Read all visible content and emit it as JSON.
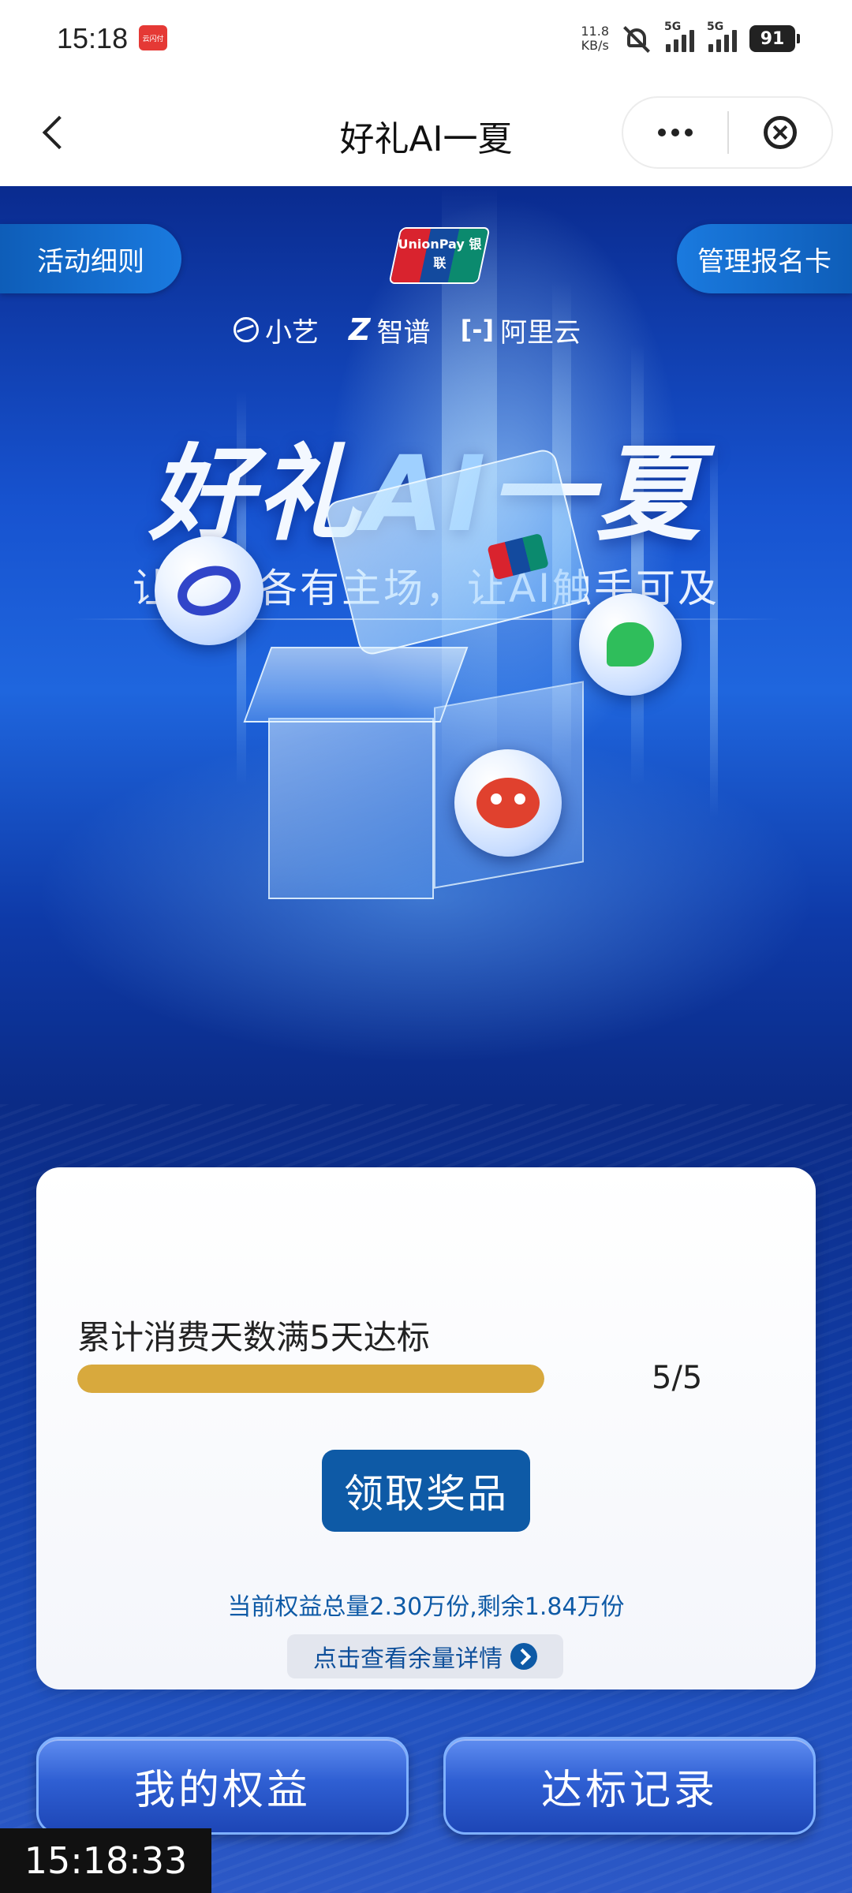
{
  "status_bar": {
    "time": "15:18",
    "app_badge": "云闪付",
    "net_speed_value": "11.8",
    "net_speed_unit": "KB/s",
    "signal_1_tag": "5G",
    "signal_2_tag": "5G",
    "battery": "91"
  },
  "nav": {
    "title": "好礼AI一夏"
  },
  "hero": {
    "rules_label": "活动细则",
    "manage_label": "管理报名卡",
    "unionpay_logo_text": "UnionPay 银联",
    "partners": [
      {
        "name": "小艺",
        "icon": "xiaoyi-icon"
      },
      {
        "name": "智谱",
        "icon": "zhipu-icon"
      },
      {
        "name": "阿里云",
        "icon": "aliyun-icon"
      }
    ],
    "title_part1": "好礼",
    "title_ai": "AI",
    "title_part2": "一夏",
    "subtitle": "让热爱各有主场，让AI触手可及"
  },
  "progress": {
    "task_label": "累计消费天数满5天达标",
    "count_text": "5/5",
    "current": 5,
    "target": 5,
    "fill_color": "#d8a93d"
  },
  "claim_button_label": "领取奖品",
  "quota_text": "当前权益总量2.30万份,剩余1.84万份",
  "detail_link_label": "点击查看余量详情",
  "bottom_buttons": {
    "my_benefits": "我的权益",
    "records": "达标记录"
  },
  "overlay_clock": "15:18:33",
  "colors": {
    "accent_blue": "#0e5aa6",
    "progress_gold": "#d8a93d",
    "hero_blue": "#1753d0"
  }
}
